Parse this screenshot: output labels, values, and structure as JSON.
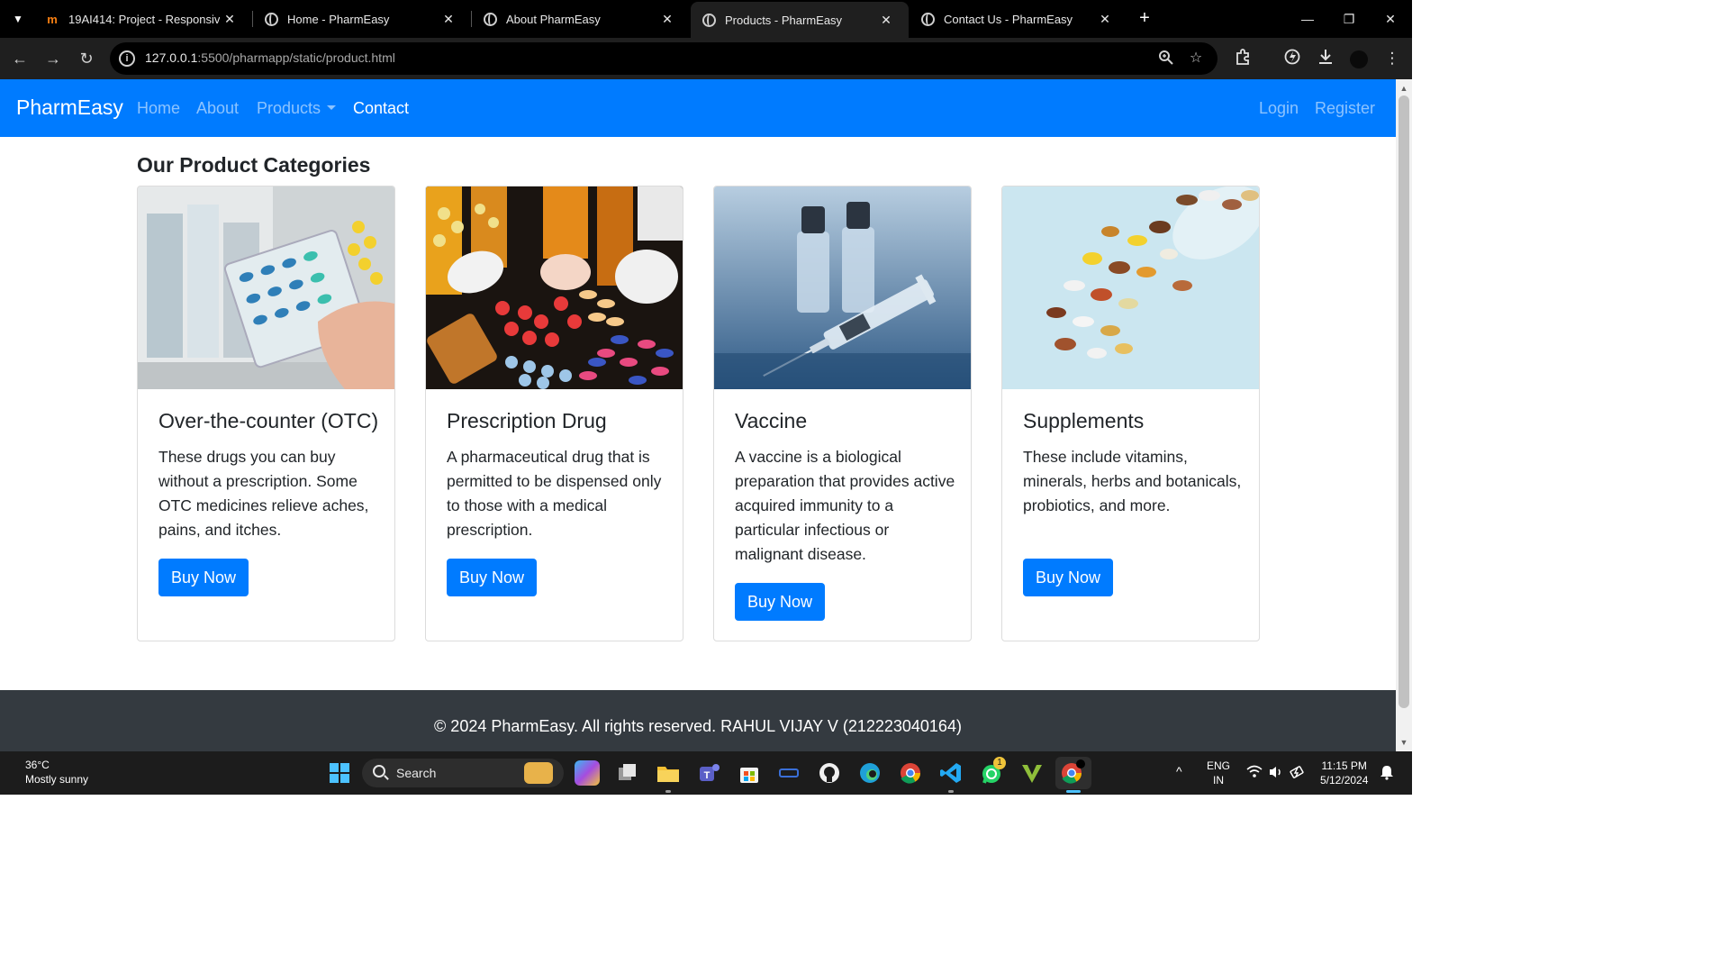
{
  "browser": {
    "tabs": [
      {
        "title": "19AI414: Project - Responsive W",
        "icon": "moodle-icon"
      },
      {
        "title": "Home - PharmEasy",
        "icon": "globe-icon"
      },
      {
        "title": "About PharmEasy",
        "icon": "globe-icon"
      },
      {
        "title": "Products - PharmEasy",
        "icon": "globe-icon",
        "active": true
      },
      {
        "title": "Contact Us - PharmEasy",
        "icon": "globe-icon"
      }
    ],
    "url_host": "127.0.0.1",
    "url_rest": ":5500/pharmapp/static/product.html"
  },
  "navbar": {
    "brand": "PharmEasy",
    "links": {
      "home": "Home",
      "about": "About",
      "products": "Products",
      "contact": "Contact"
    },
    "login": "Login",
    "register": "Register",
    "color": "#007bff"
  },
  "main": {
    "heading": "Our Product Categories",
    "cards": [
      {
        "title": "Over-the-counter (OTC)",
        "text": "These drugs you can buy without a prescription. Some OTC medicines relieve aches, pains, and itches.",
        "button": "Buy Now",
        "image": "otc-pills-image"
      },
      {
        "title": "Prescription Drug",
        "text": "A pharmaceutical drug that is permitted to be dispensed only to those with a medical prescription.",
        "button": "Buy Now",
        "image": "prescription-pills-image"
      },
      {
        "title": "Vaccine",
        "text": "A vaccine is a biological preparation that provides active acquired immunity to a particular infectious or malignant disease.",
        "button": "Buy Now",
        "image": "vaccine-vials-image"
      },
      {
        "title": "Supplements",
        "text": "These include vitamins, minerals, herbs and botanicals, probiotics, and more.",
        "button": "Buy Now",
        "image": "supplements-capsules-image"
      }
    ]
  },
  "footer": {
    "text": "© 2024 PharmEasy. All rights reserved. RAHUL VIJAY V (212223040164)"
  },
  "taskbar": {
    "weather_temp": "36°C",
    "weather_desc": "Mostly sunny",
    "search_label": "Search",
    "lang_top": "ENG",
    "lang_bottom": "IN",
    "time": "11:15 PM",
    "date": "5/12/2024",
    "whatsapp_badge": "1"
  }
}
